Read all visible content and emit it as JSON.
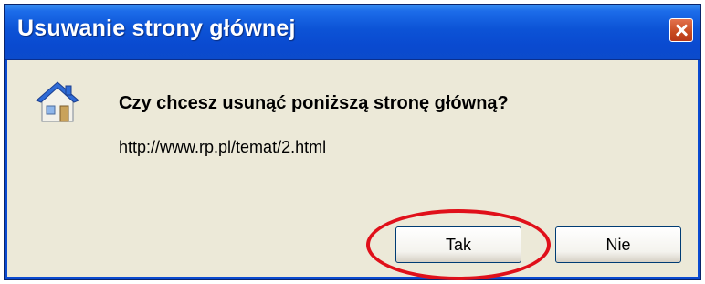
{
  "dialog": {
    "title": "Usuwanie strony głównej",
    "question": "Czy chcesz usunąć poniższą stronę główną?",
    "url": "http://www.rp.pl/temat/2.html",
    "buttons": {
      "yes_label": "Tak",
      "no_label": "Nie"
    }
  },
  "icons": {
    "main": "home-icon",
    "close": "close-icon"
  },
  "colors": {
    "titlebar": "#0a4ad0",
    "dialog_background": "#ece9d8",
    "highlight": "#e0101a"
  }
}
